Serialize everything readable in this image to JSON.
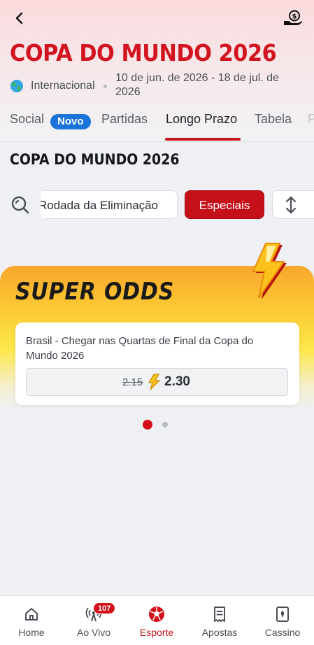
{
  "header": {
    "title": "COPA DO MUNDO 2026",
    "region": "Internacional",
    "dates": "10 de jun. de 2026 - 18 de jul. de 2026"
  },
  "tabs": [
    {
      "label": "Social",
      "badge": "Novo"
    },
    {
      "label": "Partidas"
    },
    {
      "label": "Longo Prazo",
      "active": true
    },
    {
      "label": "Tabela"
    },
    {
      "label": "F"
    }
  ],
  "section": {
    "title": "COPA DO MUNDO 2026"
  },
  "filters": {
    "chip1": "Rodada da Eliminação",
    "chip2": "Especiais"
  },
  "super_odds": {
    "title": "SUPER ODDS",
    "bet": {
      "description": "Brasil - Chegar nas Quartas de Final da Copa do Mundo 2026",
      "old_odds": "2.15",
      "new_odds": "2.30"
    },
    "pagination": {
      "pages": 2,
      "current": 1
    }
  },
  "bottom_nav": [
    {
      "label": "Home",
      "icon": "home-icon"
    },
    {
      "label": "Ao Vivo",
      "icon": "live-broadcast-icon",
      "badge": "107"
    },
    {
      "label": "Esporte",
      "icon": "soccer-ball-icon",
      "active": true
    },
    {
      "label": "Apostas",
      "icon": "bet-slip-icon"
    },
    {
      "label": "Cassino",
      "icon": "playing-card-icon"
    }
  ],
  "colors": {
    "brand_red": "#d1141f",
    "badge_blue": "#1a73d9",
    "super_odds_yellow": "#fcc934"
  }
}
